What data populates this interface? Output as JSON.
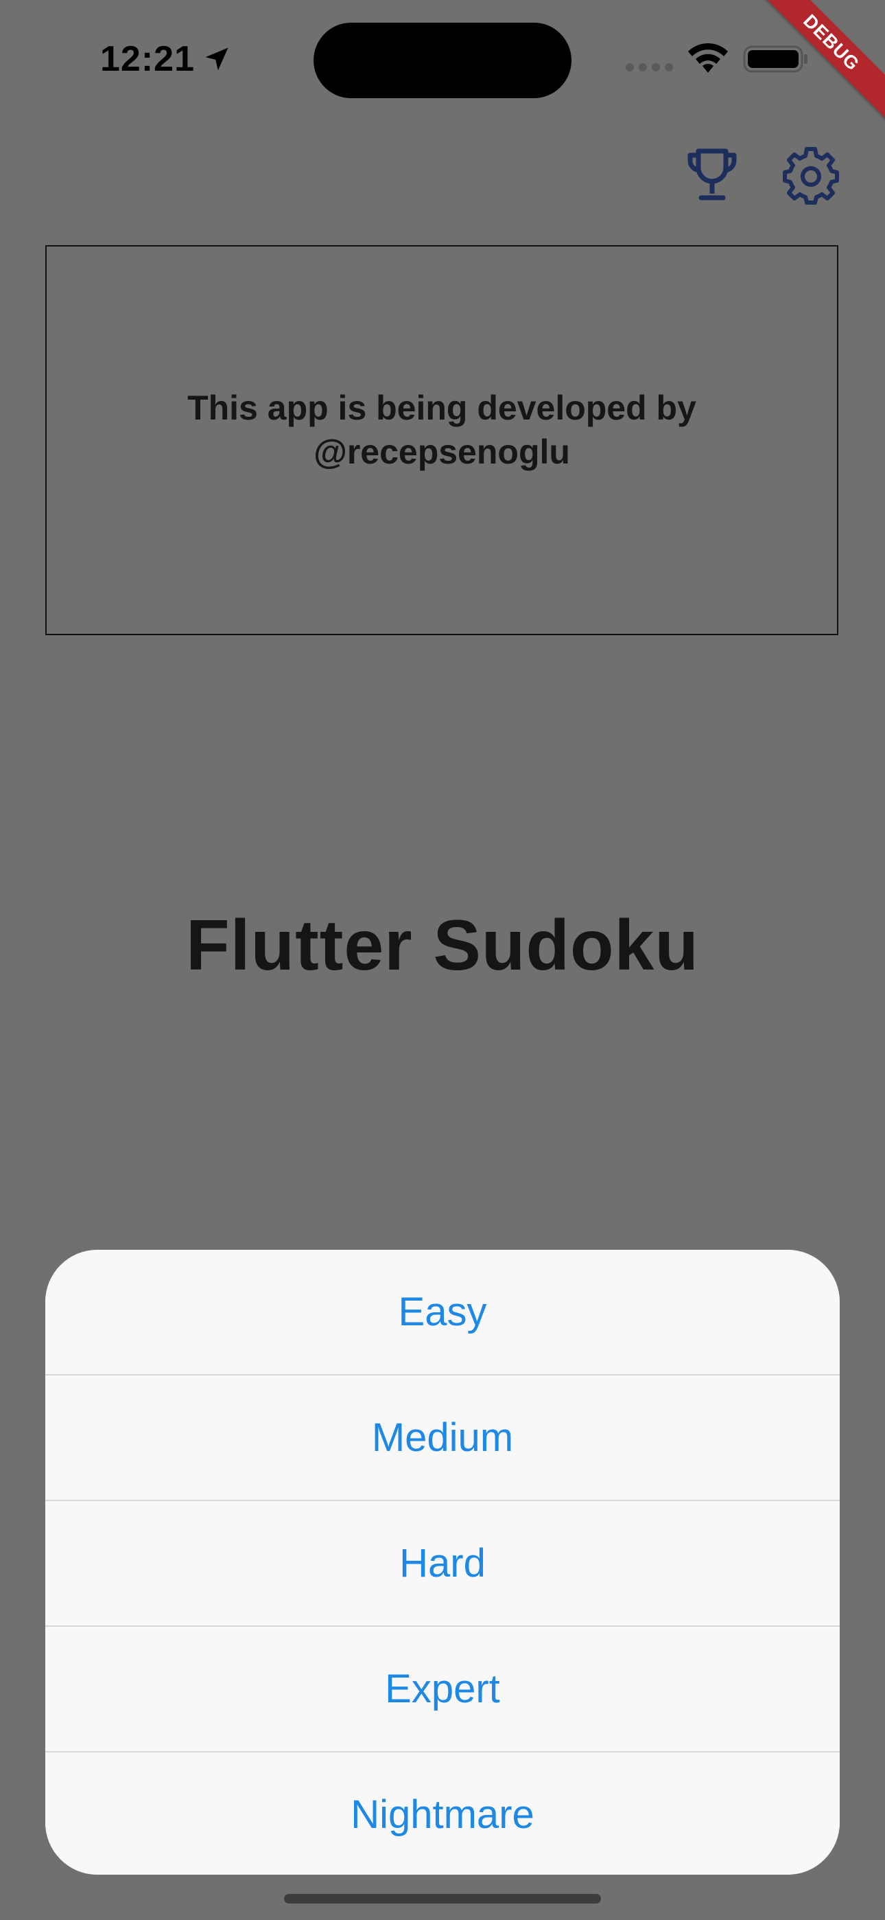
{
  "status_bar": {
    "time": "12:21"
  },
  "debug_banner": {
    "label": "DEBUG"
  },
  "app_bar": {
    "actions": [
      {
        "icon": "trophy-icon"
      },
      {
        "icon": "gear-icon"
      }
    ],
    "icon_color": "#1d2d5c"
  },
  "banner": {
    "text": "This app is being developed by @recepsenoglu"
  },
  "title": "Flutter Sudoku",
  "difficulty_sheet": {
    "options": [
      {
        "label": "Easy"
      },
      {
        "label": "Medium"
      },
      {
        "label": "Hard"
      },
      {
        "label": "Expert"
      },
      {
        "label": "Nightmare"
      }
    ],
    "accent_color": "#1e88e5"
  },
  "colors": {
    "background_overlay": "#707070",
    "sheet_background": "#f8f8f8",
    "debug_banner": "#b2272c"
  }
}
